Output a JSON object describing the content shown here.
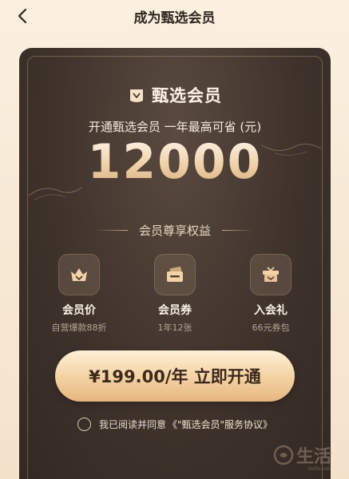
{
  "header": {
    "title": "成为甄选会员",
    "back_icon": "chevron-left-icon"
  },
  "card": {
    "brand_icon": "diamond-badge-icon",
    "brand_name": "甄选会员",
    "subtitle": "开通甄选会员 一年最高可省 (元)",
    "amount": "12000",
    "benefits_title": "会员尊享权益",
    "benefits": [
      {
        "icon": "basket-icon",
        "name": "会员价",
        "desc": "自营爆款88折"
      },
      {
        "icon": "coupon-icon",
        "name": "会员券",
        "desc": "1年12张"
      },
      {
        "icon": "gift-icon",
        "name": "入会礼",
        "desc": "66元券包"
      }
    ],
    "cta_label": "¥199.00/年 立即开通",
    "agreement_prefix": "我已阅读并同意",
    "agreement_link": "《\"甄选会员\"服务协议》"
  },
  "watermark": {
    "text": "生活",
    "url": "3elife.net"
  },
  "colors": {
    "accent_gold": "#e6b77e",
    "card_dark": "#3f332c",
    "background": "#f8ead7"
  }
}
